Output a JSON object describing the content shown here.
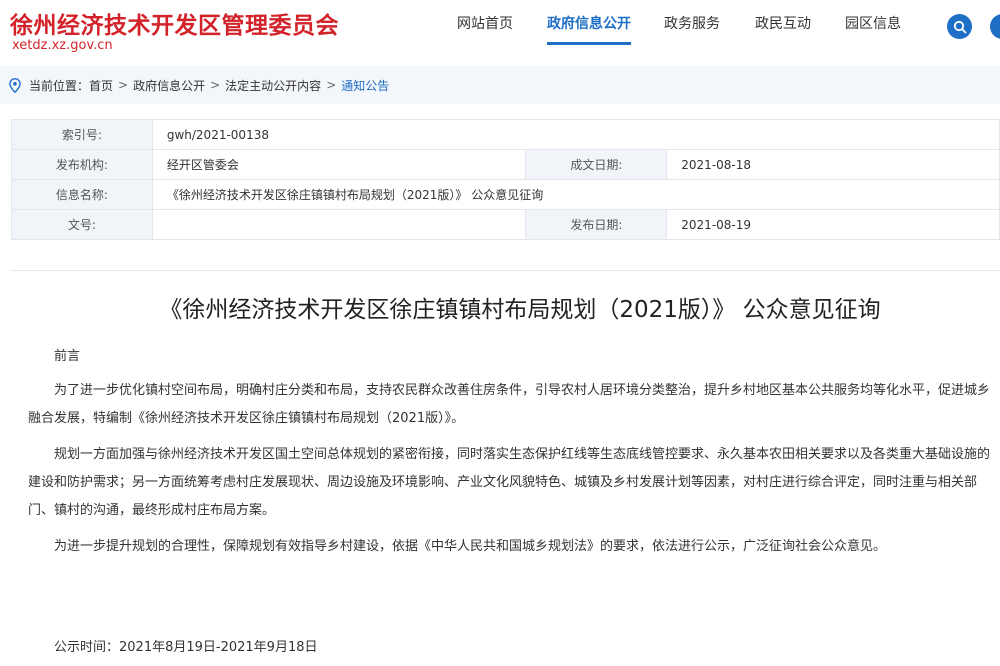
{
  "header": {
    "site_title": "徐州经济技术开发区管理委员会",
    "site_domain": "xetdz.xz.gov.cn",
    "nav": [
      {
        "label": "网站首页"
      },
      {
        "label": "政府信息公开"
      },
      {
        "label": "政务服务"
      },
      {
        "label": "政民互动"
      },
      {
        "label": "园区信息"
      }
    ],
    "accent_color": "#1f6fc6",
    "brand_color": "#d3232a"
  },
  "breadcrumb": {
    "prefix": "当前位置：",
    "items": [
      "首页",
      "政府信息公开",
      "法定主动公开内容",
      "通知公告"
    ],
    "separator": ">"
  },
  "meta": {
    "index_label": "索引号:",
    "index_value": "gwh/2021-00138",
    "org_label": "发布机构:",
    "org_value": "经开区管委会",
    "created_label": "成文日期:",
    "created_value": "2021-08-18",
    "name_label": "信息名称:",
    "name_value": "《徐州经济技术开发区徐庄镇镇村布局规划（2021版）》 公众意见征询",
    "docno_label": "文号:",
    "docno_value": "",
    "published_label": "发布日期:",
    "published_value": "2021-08-19"
  },
  "article": {
    "title": "《徐州经济技术开发区徐庄镇镇村布局规划（2021版）》 公众意见征询",
    "paragraphs": [
      "前言",
      "为了进一步优化镇村空间布局，明确村庄分类和布局，支持农民群众改善住房条件，引导农村人居环境分类整治，提升乡村地区基本公共服务均等化水平，促进城乡融合发展，特编制《徐州经济技术开发区徐庄镇镇村布局规划（2021版）》。",
      "规划一方面加强与徐州经济技术开发区国土空间总体规划的紧密衔接，同时落实生态保护红线等生态底线管控要求、永久基本农田相关要求以及各类重大基础设施的建设和防护需求；另一方面统筹考虑村庄发展现状、周边设施及环境影响、产业文化风貌特色、城镇及乡村发展计划等因素，对村庄进行综合评定，同时注重与相关部门、镇村的沟通，最终形成村庄布局方案。",
      "为进一步提升规划的合理性，保障规划有效指导乡村建设，依据《中华人民共和国城乡规划法》的要求，依法进行公示，广泛征询社会公众意见。"
    ],
    "notice_time": "公示时间：2021年8月19日-2021年9月18日"
  }
}
